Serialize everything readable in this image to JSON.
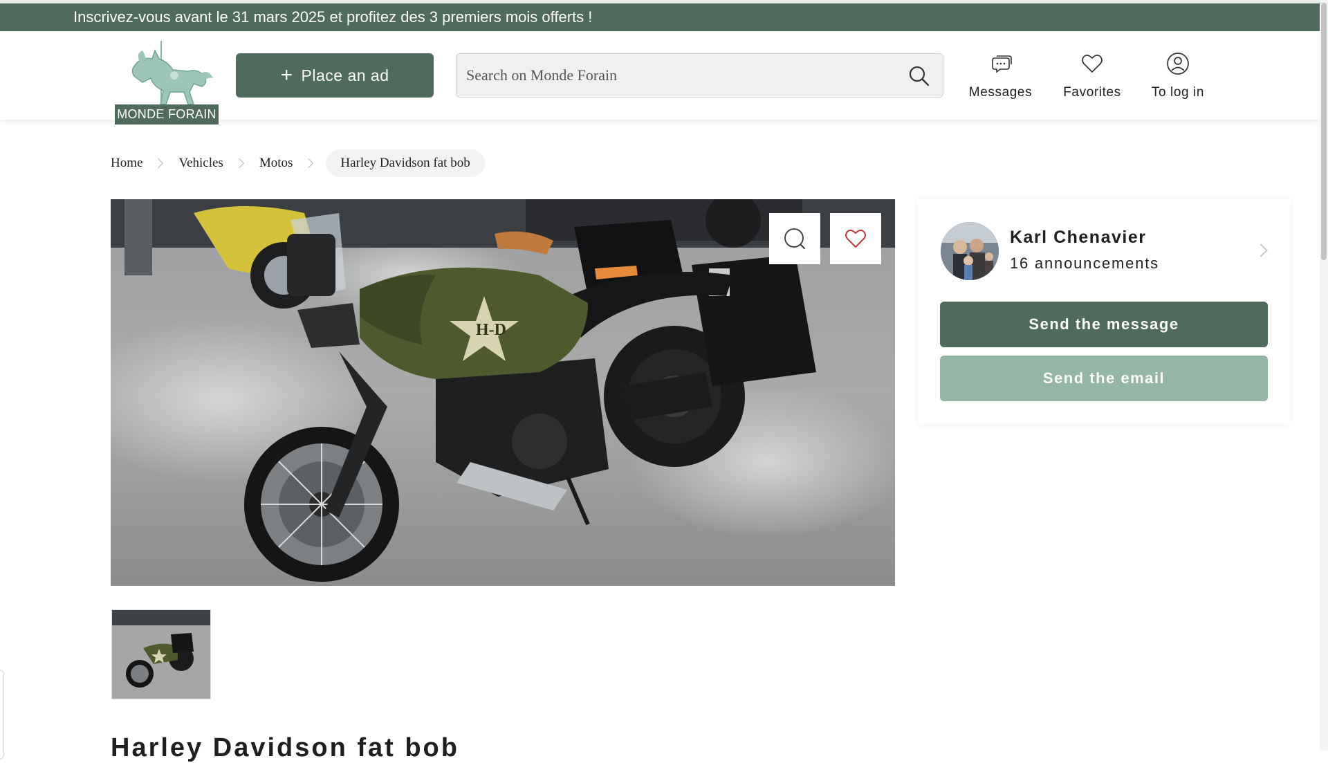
{
  "banner": {
    "text": "Inscrivez-vous avant le 31 mars 2025 et profitez des 3 premiers mois offerts !"
  },
  "header": {
    "logo_text": "MONDE FORAIN",
    "place_ad_label": "Place an ad",
    "search_placeholder": "Search on Monde Forain",
    "nav": {
      "messages": "Messages",
      "favorites": "Favorites",
      "login": "To log in"
    }
  },
  "breadcrumb": {
    "items": [
      "Home",
      "Vehicles",
      "Motos"
    ],
    "current": "Harley Davidson fat bob"
  },
  "listing": {
    "title": "Harley Davidson fat bob",
    "tank_logo": "H-D"
  },
  "seller": {
    "name": "Karl Chenavier",
    "announcements": "16 announcements",
    "send_message_label": "Send the message",
    "send_email_label": "Send the email"
  },
  "colors": {
    "brand": "#4e6b5b",
    "brand_light": "#94b7a5"
  },
  "icons": {
    "place_ad": "plus-icon",
    "search": "search-icon",
    "messages": "chat-bubbles-icon",
    "favorites": "heart-icon",
    "login": "user-circle-icon",
    "zoom": "magnifier-icon",
    "favorite_listing": "heart-outline-icon"
  }
}
